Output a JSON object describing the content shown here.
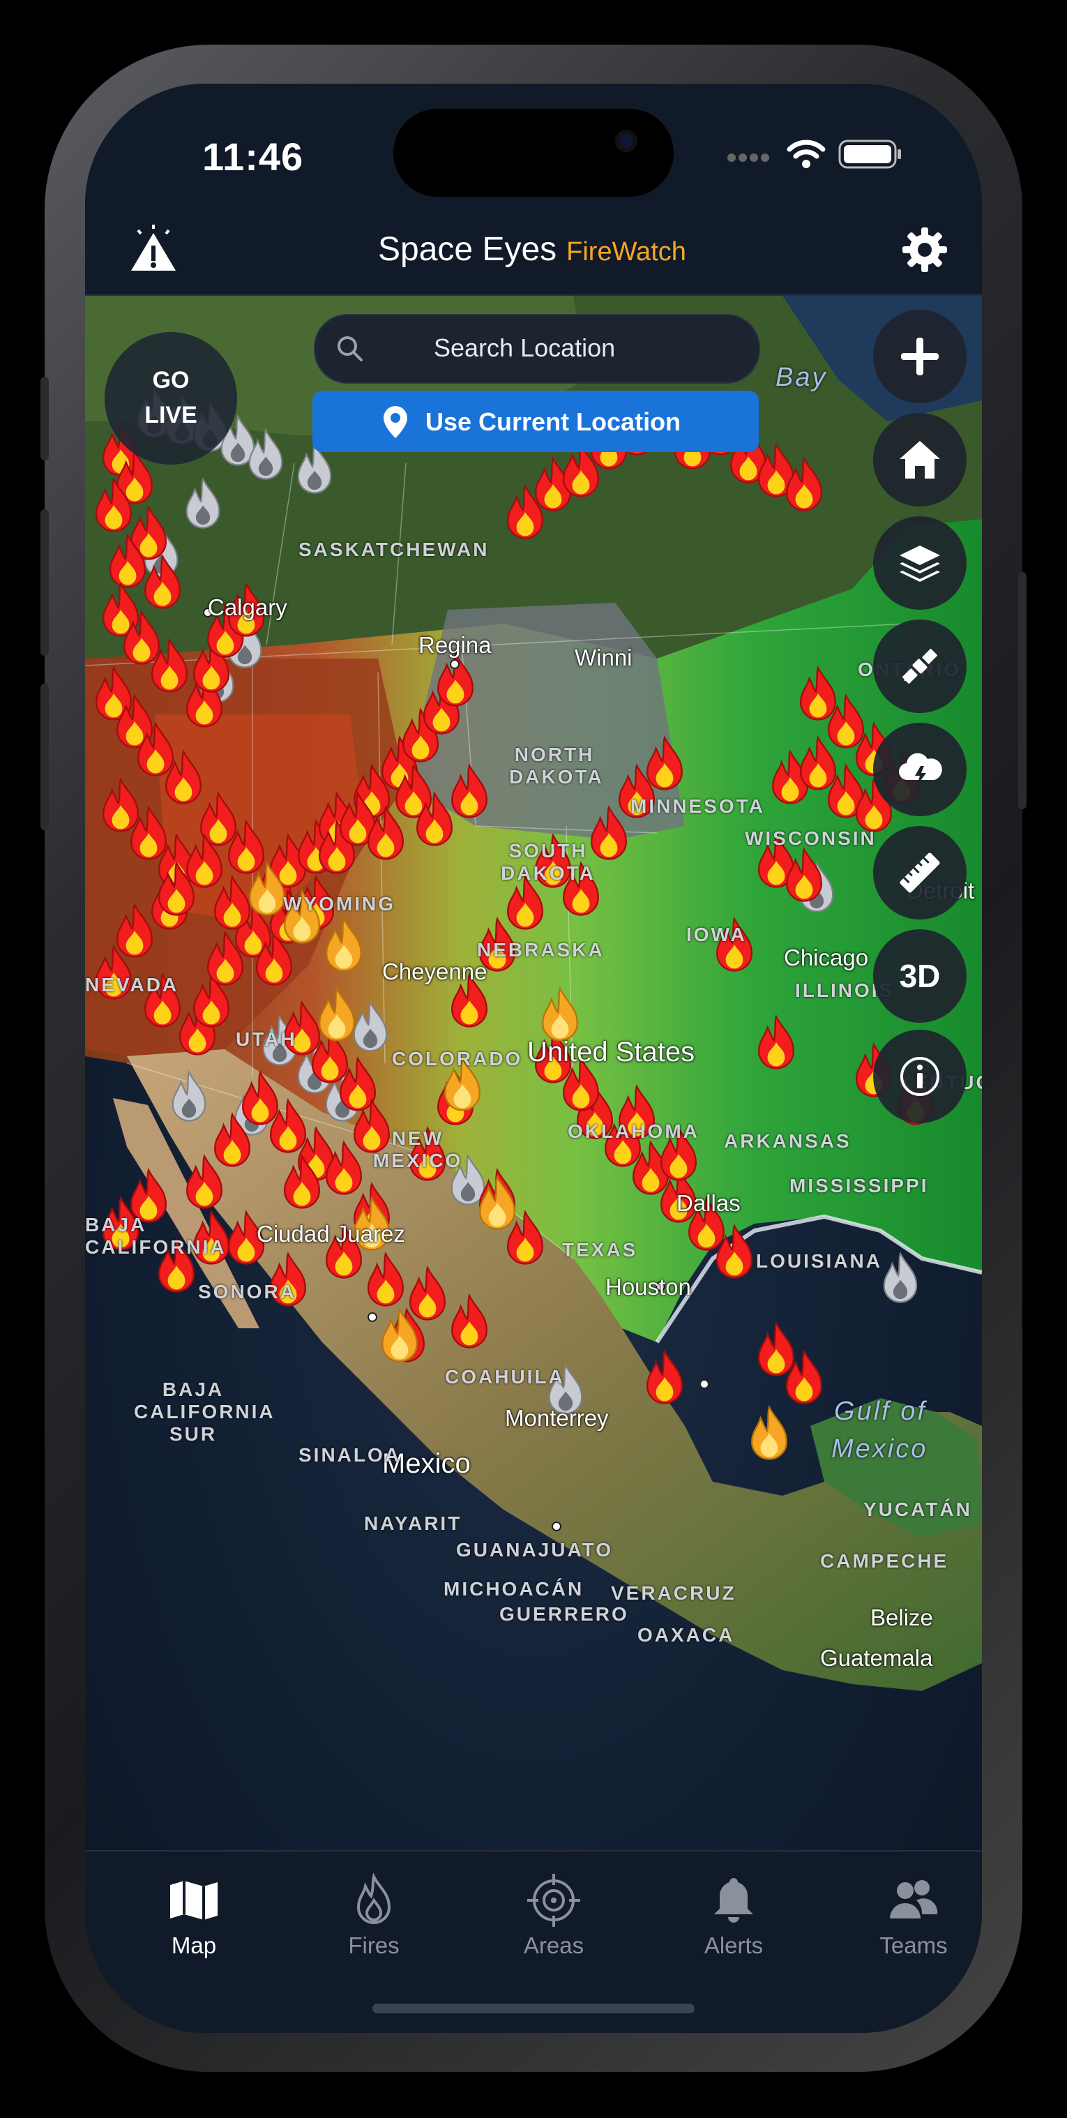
{
  "status_bar": {
    "time": "11:46"
  },
  "header": {
    "brand": "Space Eyes",
    "product": "FireWatch",
    "alert_icon": "warning-light-icon",
    "settings_icon": "gear-icon"
  },
  "search": {
    "placeholder": "Search Location",
    "use_current": "Use Current Location"
  },
  "go_live": {
    "line1": "GO",
    "line2": "LIVE"
  },
  "map_controls": [
    {
      "name": "zoom-in-button",
      "icon": "plus-icon"
    },
    {
      "name": "home-button",
      "icon": "home-icon"
    },
    {
      "name": "layers-button",
      "icon": "layers-icon"
    },
    {
      "name": "satellite-button",
      "icon": "satellite-icon"
    },
    {
      "name": "weather-button",
      "icon": "storm-cloud-icon"
    },
    {
      "name": "measure-button",
      "icon": "ruler-icon"
    },
    {
      "name": "3d-button",
      "label": "3D"
    },
    {
      "name": "info-button",
      "icon": "info-icon"
    }
  ],
  "map": {
    "cities": [
      "Calgary",
      "Regina",
      "Winni",
      "Cheyenne",
      "Chicago",
      "United States",
      "Detroit",
      "Dallas",
      "Houston",
      "Ciudad Juarez",
      "Monterrey",
      "Mexico",
      "Belize",
      "Guatemala"
    ],
    "regions": [
      "SASKATCHEWAN",
      "ONTARIO",
      "NORTH DAKOTA",
      "MINNESOTA",
      "SOUTH DAKOTA",
      "WISCONSIN",
      "WYOMING",
      "NEBRASKA",
      "IOWA",
      "NEVADA",
      "ILLINOIS",
      "UTAH",
      "COLORADO",
      "KENTUCKY",
      "OKLAHOMA",
      "ARKANSAS",
      "NEW MEXICO",
      "MISSISSIPPI",
      "TEXAS",
      "LOUISIANA",
      "BAJA CALIFORNIA",
      "SONORA",
      "COAHUILA",
      "BAJA CALIFORNIA SUR",
      "SINALOA",
      "NAYARIT",
      "GUANAJUATO",
      "MICHOACÁN",
      "VERACRUZ",
      "GUERRERO",
      "OAXACA",
      "YUCATÁN",
      "CAMPECHE"
    ],
    "water": [
      "Bay",
      "Gulf of",
      "Mexico"
    ],
    "colors": {
      "fire_red": "#f21d1d",
      "fire_yellow": "#f5a623",
      "smoke_grey": "#c8ccd2"
    }
  },
  "tabs": [
    {
      "label": "Map",
      "icon": "map-icon",
      "active": true
    },
    {
      "label": "Fires",
      "icon": "flame-icon",
      "active": false
    },
    {
      "label": "Areas",
      "icon": "crosshair-icon",
      "active": false
    },
    {
      "label": "Alerts",
      "icon": "bell-icon",
      "active": false
    },
    {
      "label": "Teams",
      "icon": "people-icon",
      "active": false
    }
  ]
}
